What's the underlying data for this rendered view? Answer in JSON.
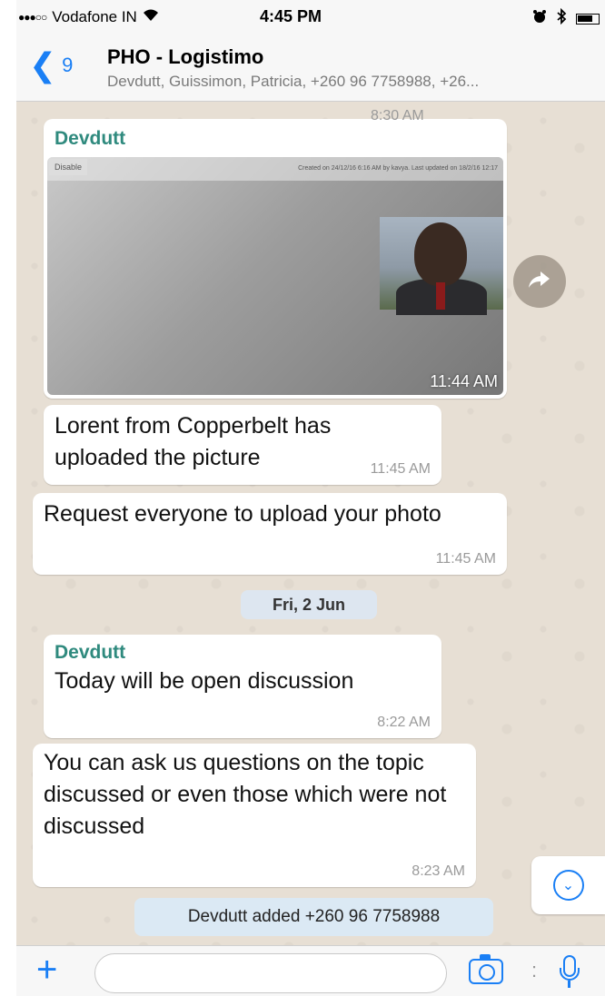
{
  "status_bar": {
    "signal": "●●●○○",
    "carrier": "Vodafone IN",
    "wifi_icon": "wifi-icon",
    "time": "4:45 PM",
    "alarm_icon": "alarm-icon",
    "bluetooth_icon": "bluetooth-icon",
    "battery_icon": "battery-icon"
  },
  "header": {
    "back_count": "9",
    "title": "PHO - Logistimo",
    "subtitle": "Devdutt, Guissimon, Patricia, +260 96 7758988, +26..."
  },
  "messages": {
    "prev_time": "8:30 AM",
    "photo": {
      "sender": "Devdutt",
      "overlay_tag": "Disable",
      "overlay_meta": "Created on 24/12/16 6:16 AM by kavya. Last updated on 18/2/16 12:17",
      "time": "11:44 AM"
    },
    "m2": {
      "text": "Lorent from Copperbelt has uploaded the picture",
      "time": "11:45 AM"
    },
    "m3": {
      "text": "Request everyone to upload your photo",
      "time": "11:45 AM"
    },
    "date_divider": "Fri, 2 Jun",
    "m4": {
      "sender": "Devdutt",
      "text": "Today will be open discussion",
      "time": "8:22 AM"
    },
    "m5": {
      "text": "You can ask us questions on the topic discussed or even those which were not discussed",
      "time": "8:23 AM"
    },
    "system_notice": "Devdutt added +260 96 7758988"
  },
  "input": {
    "placeholder": ""
  },
  "colors": {
    "accent": "#1a7ff5",
    "sender_name": "#2f8a7e",
    "chat_bg": "#e7dfd4"
  }
}
